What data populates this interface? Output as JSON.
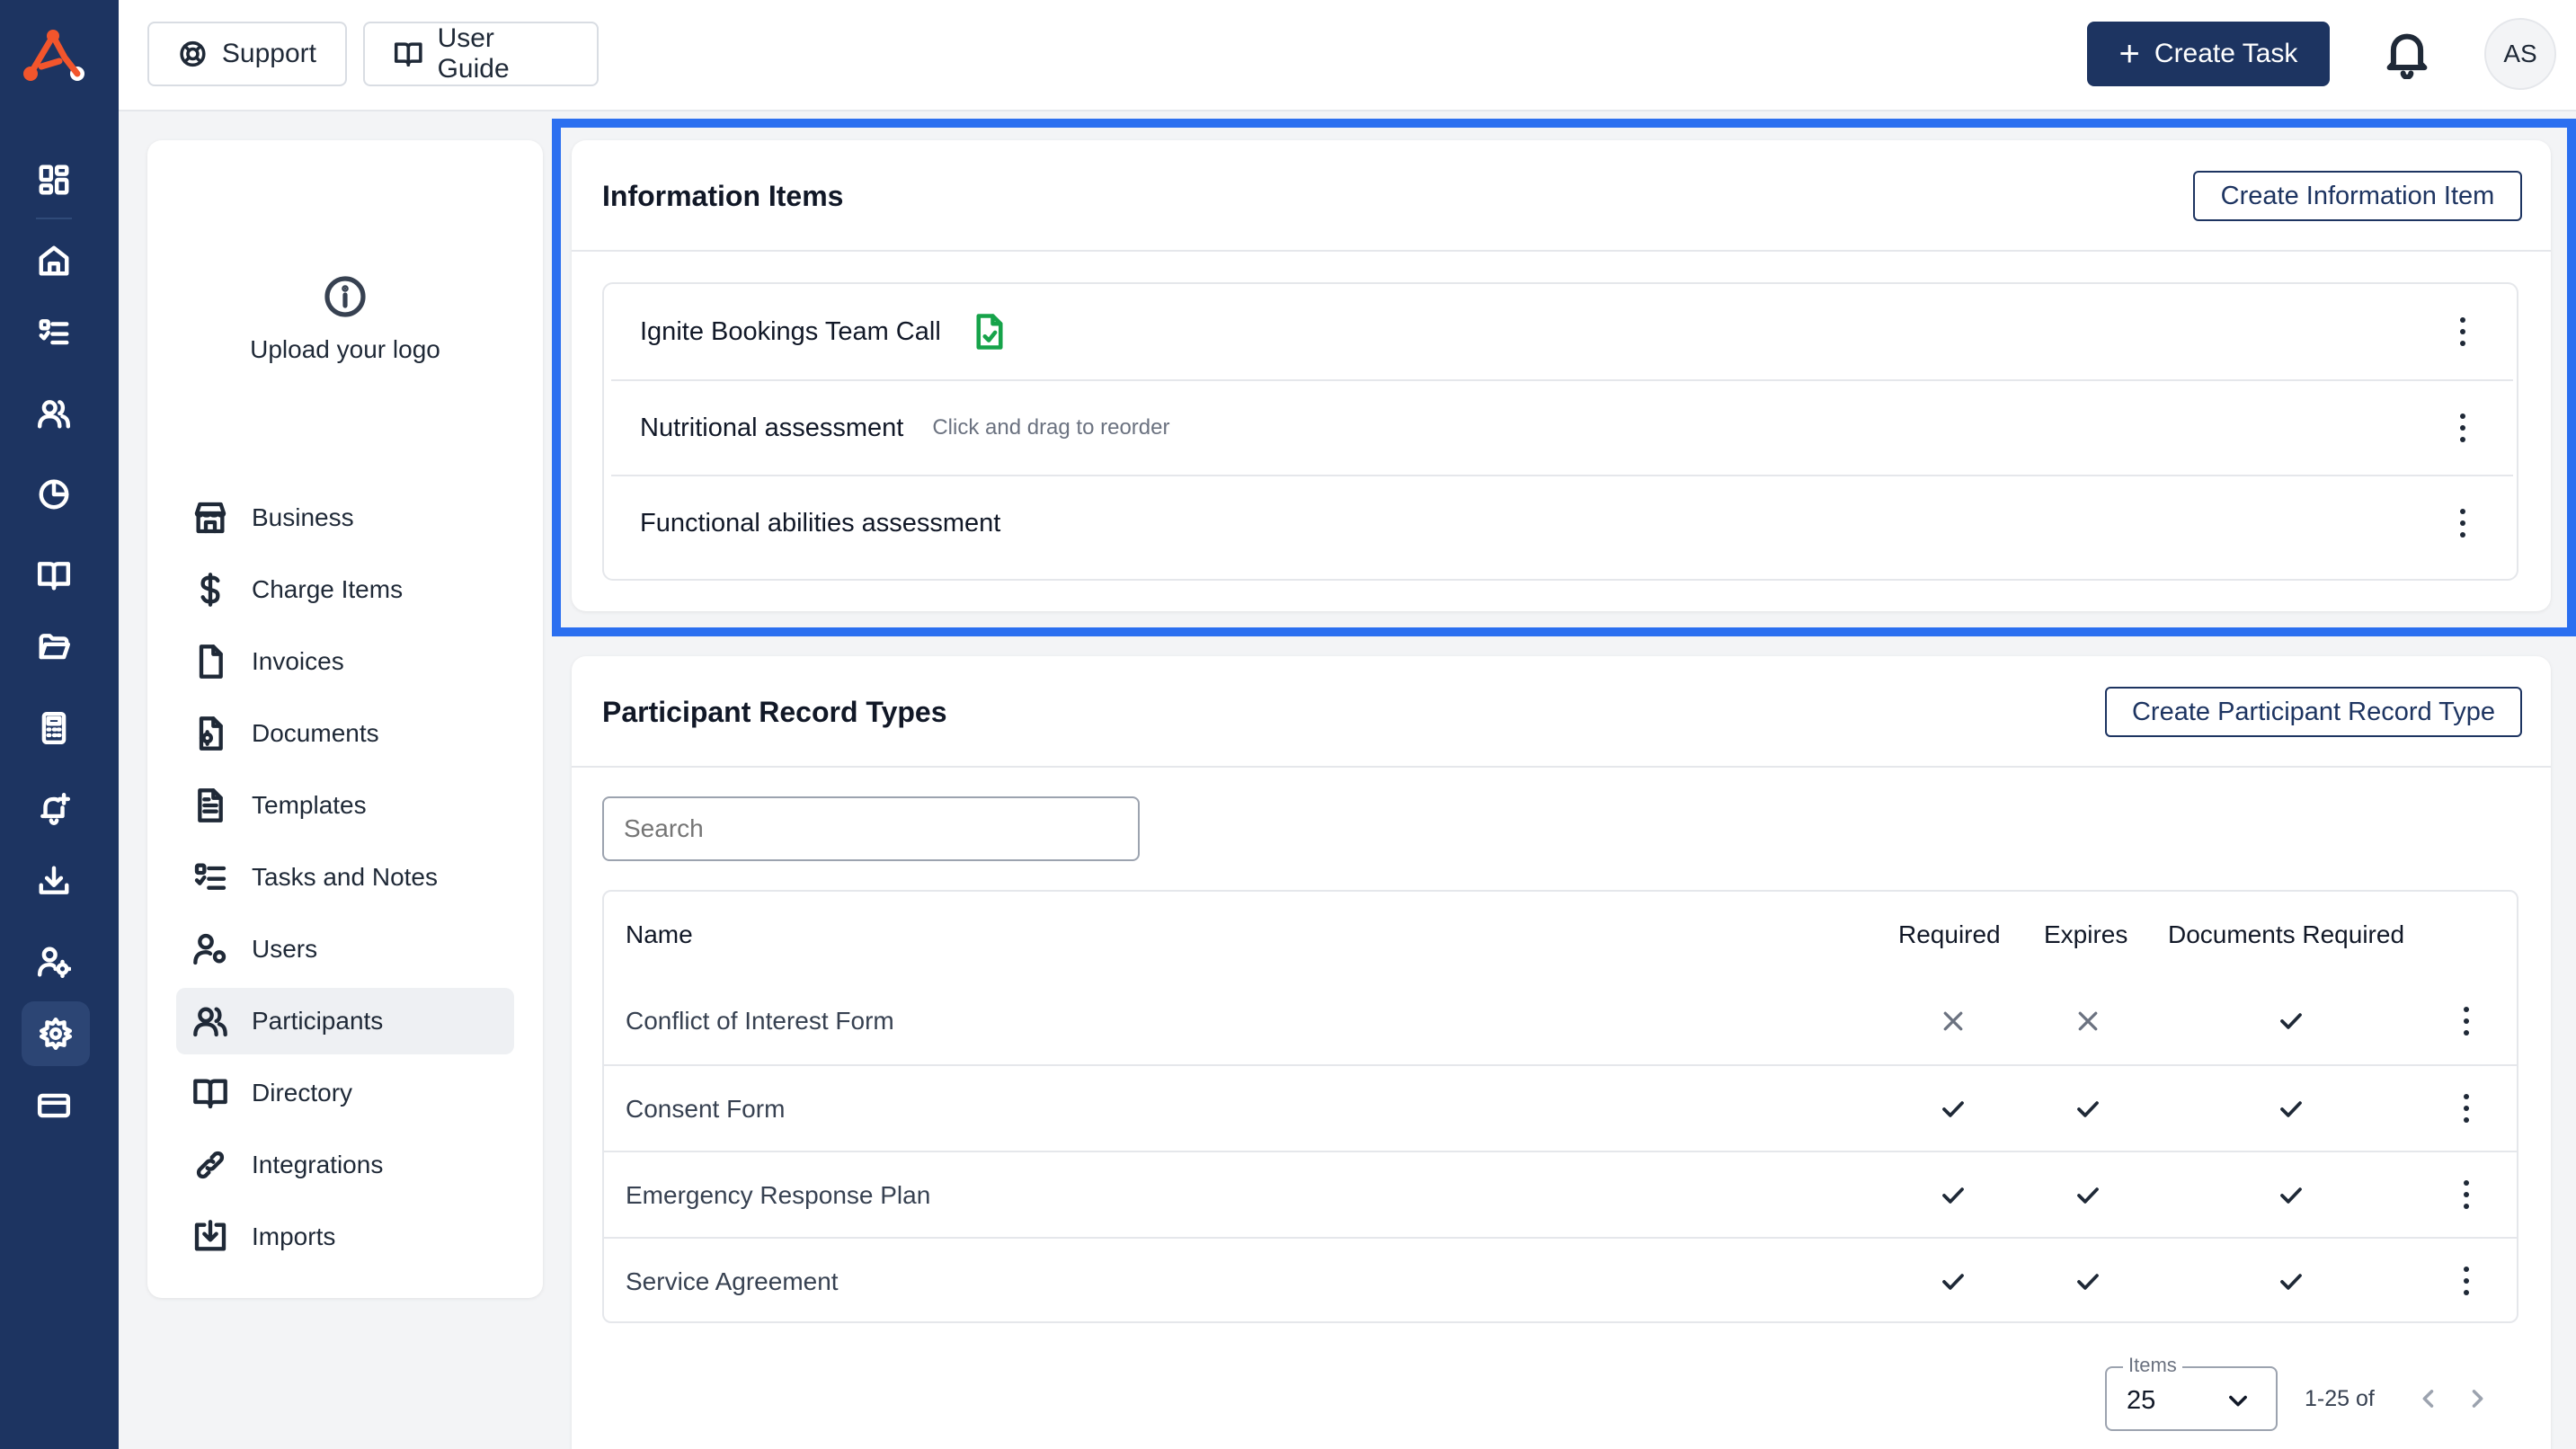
{
  "topbar": {
    "support_label": "Support",
    "user_guide_label": "User Guide",
    "create_task_label": "Create Task",
    "avatar_initials": "AS"
  },
  "rail": {
    "icons": [
      "dashboard-icon",
      "home-icon",
      "tasks-icon",
      "users-icon",
      "chart-icon",
      "book-icon",
      "folder-icon",
      "calculator-icon",
      "bell-plus-icon",
      "download-icon",
      "user-gear-icon",
      "settings-icon",
      "card-icon"
    ],
    "active": "settings-icon"
  },
  "side": {
    "upload_logo": "Upload your logo",
    "items": [
      {
        "label": "Business",
        "icon": "store-icon"
      },
      {
        "label": "Charge Items",
        "icon": "dollar-icon"
      },
      {
        "label": "Invoices",
        "icon": "file-icon"
      },
      {
        "label": "Documents",
        "icon": "document-icon"
      },
      {
        "label": "Templates",
        "icon": "template-icon"
      },
      {
        "label": "Tasks and Notes",
        "icon": "tasks-icon"
      },
      {
        "label": "Users",
        "icon": "user-gear-icon"
      },
      {
        "label": "Participants",
        "icon": "participants-icon"
      },
      {
        "label": "Directory",
        "icon": "book-icon"
      },
      {
        "label": "Integrations",
        "icon": "link-icon"
      },
      {
        "label": "Imports",
        "icon": "import-icon"
      }
    ],
    "active": "Participants"
  },
  "info_items": {
    "title": "Information Items",
    "create_label": "Create Information Item",
    "drag_hint": "Click and drag to reorder",
    "items": [
      "Ignite Bookings Team Call",
      "Nutritional assessment",
      "Functional abilities assessment"
    ]
  },
  "record_types": {
    "title": "Participant Record Types",
    "create_label": "Create Participant Record Type",
    "search_placeholder": "Search",
    "columns": [
      "Name",
      "Required",
      "Expires",
      "Documents Required"
    ],
    "rows": [
      {
        "name": "Conflict of Interest Form",
        "required": false,
        "expires": false,
        "documents_required": true
      },
      {
        "name": "Consent Form",
        "required": true,
        "expires": true,
        "documents_required": true
      },
      {
        "name": "Emergency Response Plan",
        "required": true,
        "expires": true,
        "documents_required": true
      },
      {
        "name": "Service Agreement",
        "required": true,
        "expires": true,
        "documents_required": true
      }
    ],
    "pager": {
      "legend": "Items",
      "per_page": "25",
      "range": "1-25 of"
    }
  },
  "colors": {
    "navy": "#1d3461",
    "highlight": "#2b6ff0",
    "doc_green": "#16a34a",
    "logo_orange": "#f2552c"
  }
}
